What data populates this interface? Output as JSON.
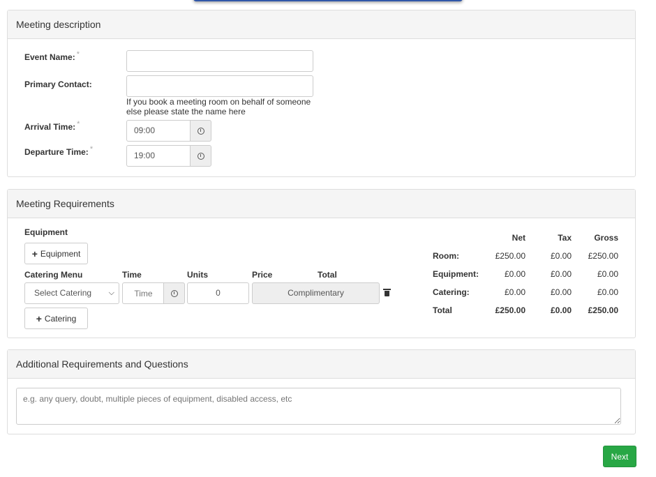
{
  "meeting_description": {
    "heading": "Meeting description",
    "event_name_label": "Event Name:",
    "primary_contact_label": "Primary Contact:",
    "primary_contact_help": "If you book a meeting room on behalf of someone else please state the name here",
    "arrival_label": "Arrival Time:",
    "arrival_value": "09:00",
    "departure_label": "Departure Time:",
    "departure_value": "19:00",
    "required_mark": "*"
  },
  "meeting_requirements": {
    "heading": "Meeting Requirements",
    "equipment_label": "Equipment",
    "add_equipment_label": "Equipment",
    "catering_columns": {
      "menu": "Catering Menu",
      "time": "Time",
      "units": "Units",
      "price": "Price",
      "total": "Total"
    },
    "catering_select_value": "Select Catering",
    "time_placeholder": "Time",
    "units_value": "0",
    "price_value": "Complimentary",
    "add_catering_label": "Catering",
    "summary": {
      "headers": [
        "Net",
        "Tax",
        "Gross"
      ],
      "rows": [
        {
          "label": "Room:",
          "net": "£250.00",
          "tax": "£0.00",
          "gross": "£250.00"
        },
        {
          "label": "Equipment:",
          "net": "£0.00",
          "tax": "£0.00",
          "gross": "£0.00"
        },
        {
          "label": "Catering:",
          "net": "£0.00",
          "tax": "£0.00",
          "gross": "£0.00"
        },
        {
          "label": "Total",
          "net": "£250.00",
          "tax": "£0.00",
          "gross": "£250.00"
        }
      ]
    }
  },
  "additional": {
    "heading": "Additional Requirements and Questions",
    "placeholder": "e.g. any query, doubt, multiple pieces of equipment, disabled access, etc"
  },
  "next_label": "Next",
  "colors": {
    "accent_bar": "#2f56a8",
    "next_button": "#28a745"
  }
}
